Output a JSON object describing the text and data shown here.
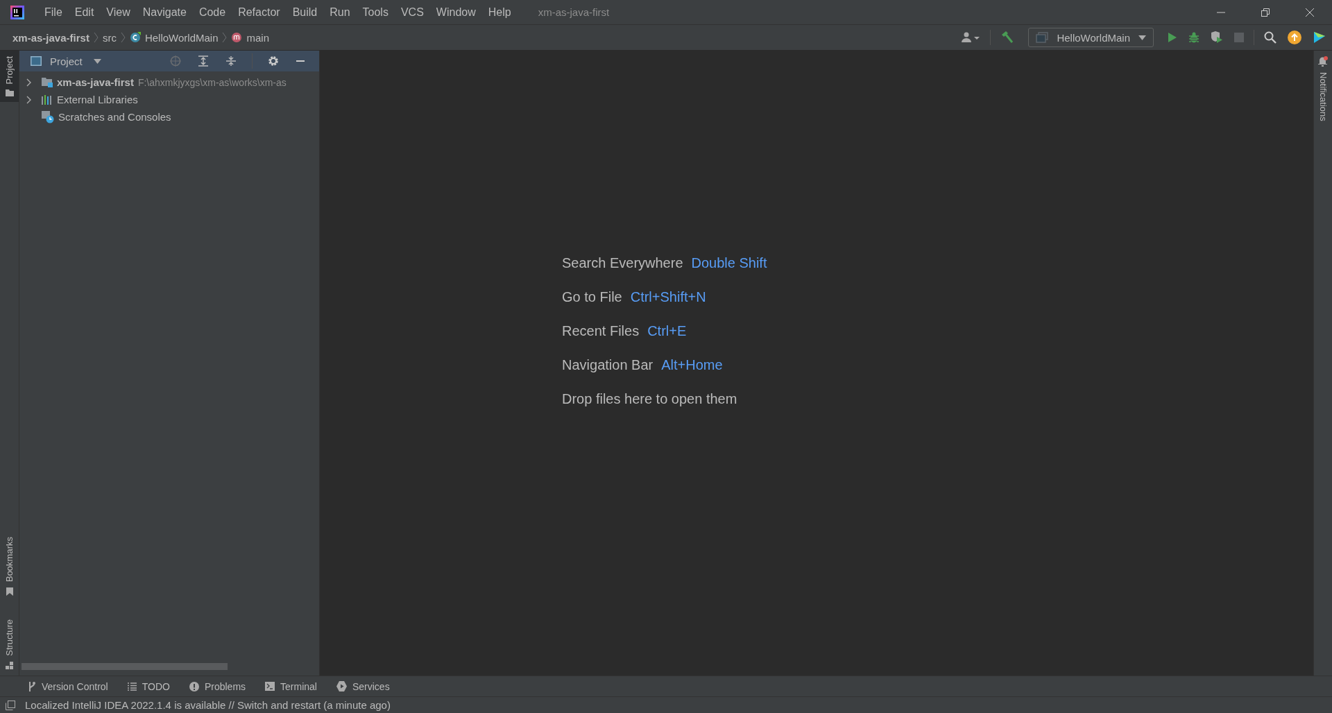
{
  "menu": [
    "File",
    "Edit",
    "View",
    "Navigate",
    "Code",
    "Refactor",
    "Build",
    "Run",
    "Tools",
    "VCS",
    "Window",
    "Help"
  ],
  "window": {
    "title": "xm-as-java-first"
  },
  "breadcrumbs": [
    {
      "kind": "project",
      "text": "xm-as-java-first"
    },
    {
      "kind": "folder",
      "text": "src"
    },
    {
      "kind": "class",
      "text": "HelloWorldMain"
    },
    {
      "kind": "method",
      "text": "main"
    }
  ],
  "run_config": {
    "label": "HelloWorldMain"
  },
  "left_strip": [
    {
      "label": "Project",
      "selected": true,
      "kind": "project"
    },
    {
      "label": "Bookmarks",
      "selected": false,
      "kind": "bookmarks"
    },
    {
      "label": "Structure",
      "selected": false,
      "kind": "structure"
    }
  ],
  "right_strip": [
    {
      "label": "Notifications",
      "selected": false
    }
  ],
  "project_panel": {
    "title": "Project",
    "tree": [
      {
        "kind": "module",
        "name": "xm-as-java-first",
        "path": "F:\\ahxmkjyxgs\\xm-as\\works\\xm-as",
        "expanded": false,
        "has_children": true
      },
      {
        "kind": "libraries",
        "name": "External Libraries",
        "expanded": false,
        "has_children": true
      },
      {
        "kind": "scratches",
        "name": "Scratches and Consoles",
        "has_children": false
      }
    ]
  },
  "welcome": {
    "hints": [
      {
        "label": "Search Everywhere",
        "shortcut": "Double Shift"
      },
      {
        "label": "Go to File",
        "shortcut": "Ctrl+Shift+N"
      },
      {
        "label": "Recent Files",
        "shortcut": "Ctrl+E"
      },
      {
        "label": "Navigation Bar",
        "shortcut": "Alt+Home"
      }
    ],
    "drop_text": "Drop files here to open them"
  },
  "bottom_tabs": [
    {
      "kind": "vcs",
      "label": "Version Control",
      "selected": false
    },
    {
      "kind": "todo",
      "label": "TODO",
      "selected": false
    },
    {
      "kind": "problems",
      "label": "Problems",
      "selected": false
    },
    {
      "kind": "terminal",
      "label": "Terminal",
      "selected": false
    },
    {
      "kind": "services",
      "label": "Services",
      "selected": false
    }
  ],
  "status_bar": {
    "message": "Localized IntelliJ IDEA 2022.1.4 is available // Switch and restart (a minute ago)"
  }
}
